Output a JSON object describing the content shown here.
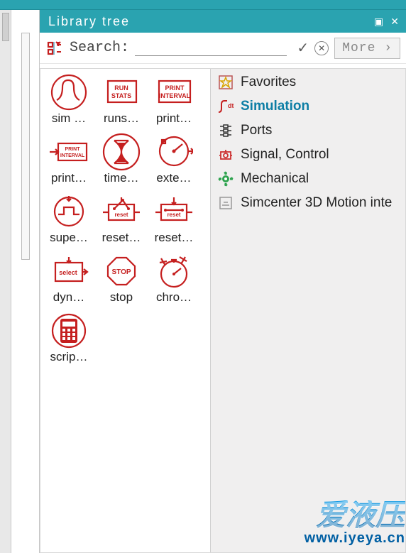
{
  "panel": {
    "title": "Library tree"
  },
  "search": {
    "label": "Search:",
    "value": "",
    "more_label": "More ›"
  },
  "library_items": [
    {
      "id": "sim",
      "label": "sim …"
    },
    {
      "id": "runs",
      "label": "runs…"
    },
    {
      "id": "print1",
      "label": "print…"
    },
    {
      "id": "print2",
      "label": "print…"
    },
    {
      "id": "time",
      "label": "time…"
    },
    {
      "id": "exte",
      "label": "exte…"
    },
    {
      "id": "supe",
      "label": "supe…"
    },
    {
      "id": "reset1",
      "label": "reset…"
    },
    {
      "id": "reset2",
      "label": "reset…"
    },
    {
      "id": "dyn",
      "label": "dyn…"
    },
    {
      "id": "stop",
      "label": "stop"
    },
    {
      "id": "chro",
      "label": "chro…"
    },
    {
      "id": "scrip",
      "label": "scrip…"
    }
  ],
  "categories": [
    {
      "id": "fav",
      "label": "Favorites",
      "selected": false
    },
    {
      "id": "sim",
      "label": "Simulation",
      "selected": true
    },
    {
      "id": "ports",
      "label": "Ports",
      "selected": false
    },
    {
      "id": "sigctrl",
      "label": "Signal, Control",
      "selected": false
    },
    {
      "id": "mech",
      "label": "Mechanical",
      "selected": false
    },
    {
      "id": "sc3d",
      "label": "Simcenter 3D Motion inte",
      "selected": false
    }
  ],
  "watermark": {
    "cn": "爱液压",
    "url": "www.iyeya.cn"
  }
}
